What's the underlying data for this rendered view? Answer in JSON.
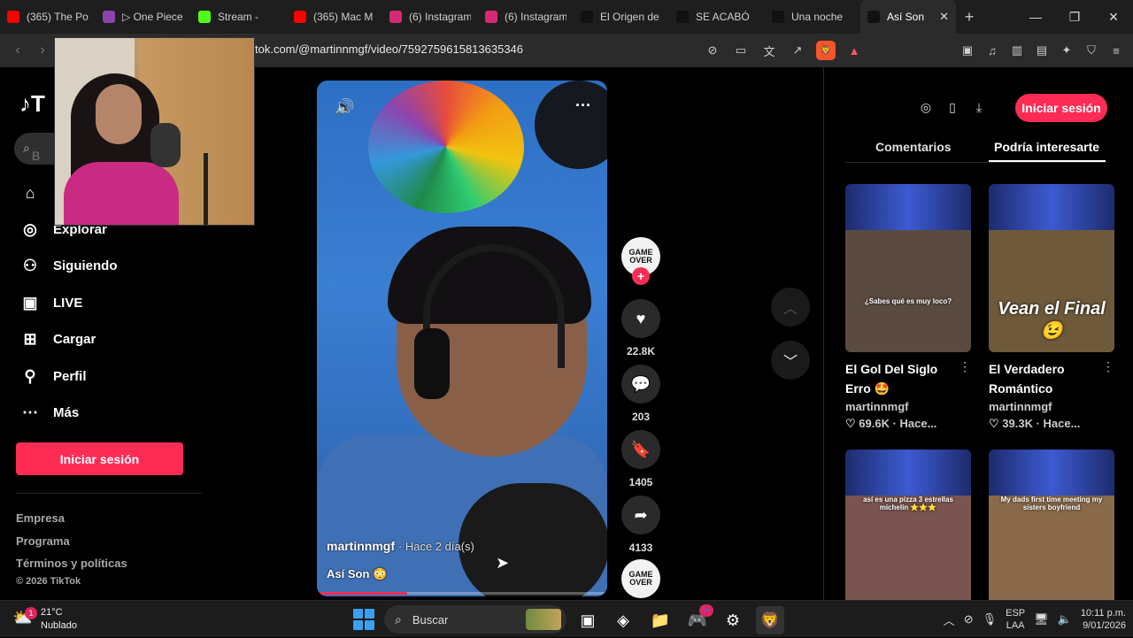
{
  "browser": {
    "tabs": [
      {
        "label": "(365) The Po",
        "icon": "youtube-icon",
        "color": "#ff0000"
      },
      {
        "label": "▷ One Piece",
        "icon": "anime-icon",
        "color": "#8e44ad"
      },
      {
        "label": "Stream -",
        "icon": "kick-icon",
        "color": "#53fc18"
      },
      {
        "label": "(365) Mac M",
        "icon": "youtube-icon",
        "color": "#ff0000"
      },
      {
        "label": "(6) Instagram",
        "icon": "instagram-icon",
        "color": "#d62976"
      },
      {
        "label": "(6) Instagram",
        "icon": "instagram-icon",
        "color": "#d62976"
      },
      {
        "label": "El Origen de",
        "icon": "tiktok-icon",
        "color": "#111111"
      },
      {
        "label": "SE ACABÓ",
        "icon": "tiktok-icon",
        "color": "#111111"
      },
      {
        "label": "Una noche",
        "icon": "tiktok-icon",
        "color": "#111111"
      },
      {
        "label": "Así Son",
        "icon": "tiktok-icon",
        "color": "#111111"
      }
    ],
    "url": "tok.com/@martinnmgf/video/7592759615813635346"
  },
  "sidebar": {
    "logo": "T",
    "search_placeholder": "B",
    "items": [
      {
        "label": "Explorar",
        "icon": "compass-icon"
      },
      {
        "label": "Siguiendo",
        "icon": "following-icon"
      },
      {
        "label": "LIVE",
        "icon": "live-icon"
      },
      {
        "label": "Cargar",
        "icon": "upload-icon"
      },
      {
        "label": "Perfil",
        "icon": "profile-icon"
      },
      {
        "label": "Más",
        "icon": "more-icon"
      }
    ],
    "login": "Iniciar sesión",
    "footer": [
      "Empresa",
      "Programa",
      "Términos y políticas"
    ],
    "copyright": "© 2026 TikTok"
  },
  "video": {
    "author": "martinnmgf",
    "time": "· Hace 2 día(s)",
    "caption": "Así Son 😳",
    "progress": 0.31
  },
  "actions": {
    "likes": "22.8K",
    "comments": "203",
    "saves": "1405",
    "shares": "4133",
    "avatar_text": "GAME OVER"
  },
  "right_panel": {
    "login": "Iniciar sesión",
    "tabs": [
      "Comentarios",
      "Podría interesarte"
    ],
    "cards": [
      {
        "title": "El Gol Del Siglo Erro 🤩",
        "author": "martinnmgf",
        "stats": "♡ 69.6K · Hace...",
        "overlay": "¿Sabes qué es muy loco?",
        "bg": "#5a4a40"
      },
      {
        "title": "El Verdadero Romántico",
        "author": "martinnmgf",
        "stats": "♡ 39.3K · Hace...",
        "overlay": "Vean el Final 😉",
        "bg": "#6e5a3a"
      },
      {
        "title": "",
        "author": "",
        "stats": "",
        "overlay": "así es una pizza 3 estrellas michelin ⭐⭐⭐",
        "bg": "#7a5450"
      },
      {
        "title": "",
        "author": "",
        "stats": "",
        "overlay": "My dads first time meeting my sisters boyfriend",
        "bg": "#8a6a4a"
      }
    ]
  },
  "taskbar": {
    "temp": "21°C",
    "weather": "Nublado",
    "weather_badge": "1",
    "search": "Buscar",
    "discord_badge": "9+",
    "lang1": "ESP",
    "lang2": "LAA",
    "time": "10:11 p.m.",
    "date": "9/01/2026"
  }
}
